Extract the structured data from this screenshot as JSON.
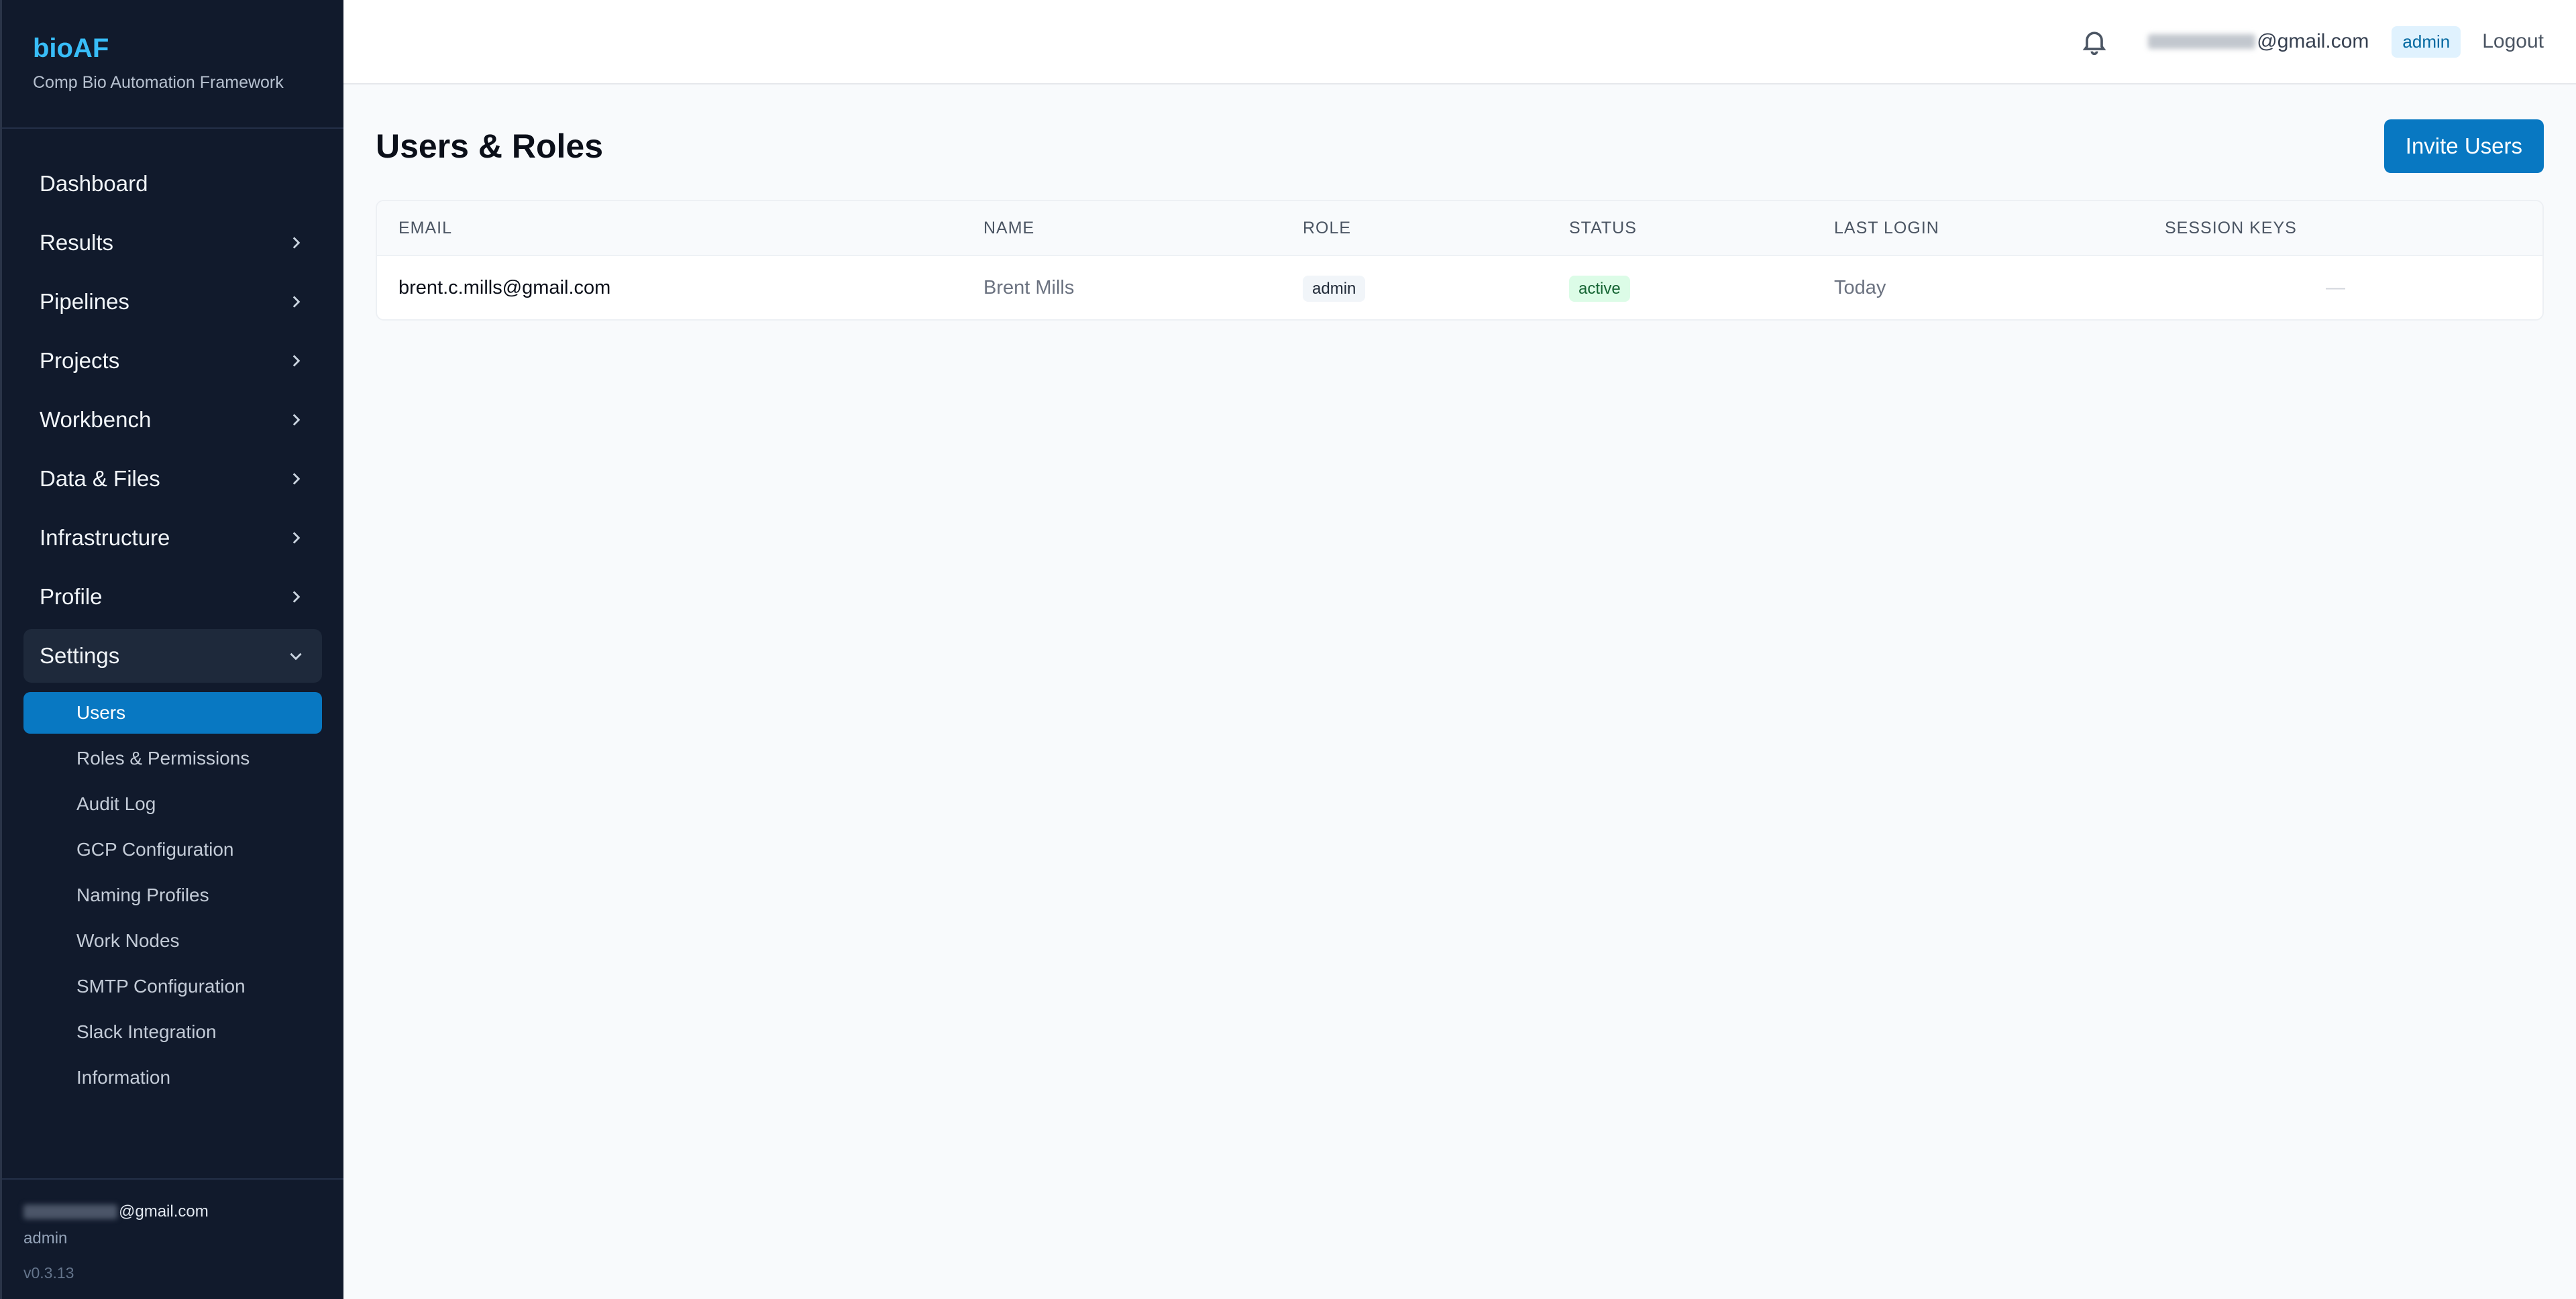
{
  "brand": {
    "title": "bioAF",
    "subtitle": "Comp Bio Automation Framework"
  },
  "nav": {
    "items": [
      {
        "label": "Dashboard"
      },
      {
        "label": "Results"
      },
      {
        "label": "Pipelines"
      },
      {
        "label": "Projects"
      },
      {
        "label": "Workbench"
      },
      {
        "label": "Data & Files"
      },
      {
        "label": "Infrastructure"
      },
      {
        "label": "Profile"
      },
      {
        "label": "Settings"
      }
    ],
    "settings_sub": [
      {
        "label": "Users"
      },
      {
        "label": "Roles & Permissions"
      },
      {
        "label": "Audit Log"
      },
      {
        "label": "GCP Configuration"
      },
      {
        "label": "Naming Profiles"
      },
      {
        "label": "Work Nodes"
      },
      {
        "label": "SMTP Configuration"
      },
      {
        "label": "Slack Integration"
      },
      {
        "label": "Information"
      }
    ]
  },
  "sidebar_footer": {
    "email_suffix": "@gmail.com",
    "role": "admin",
    "version": "v0.3.13"
  },
  "topbar": {
    "email_suffix": "@gmail.com",
    "role_badge": "admin",
    "logout": "Logout"
  },
  "page": {
    "title": "Users & Roles",
    "invite_button": "Invite Users"
  },
  "table": {
    "headers": [
      "EMAIL",
      "NAME",
      "ROLE",
      "STATUS",
      "LAST LOGIN",
      "SESSION KEYS"
    ],
    "rows": [
      {
        "email": "brent.c.mills@gmail.com",
        "name": "Brent Mills",
        "role": "admin",
        "status": "active",
        "last_login": "Today",
        "session_keys": "—"
      }
    ]
  },
  "colors": {
    "accent": "#0878c2",
    "sidebar_bg": "#111a2c",
    "brand": "#38bdf8"
  },
  "icons": {
    "bell": "bell-icon",
    "chevron_right": "chevron-right-icon",
    "chevron_down": "chevron-down-icon"
  }
}
